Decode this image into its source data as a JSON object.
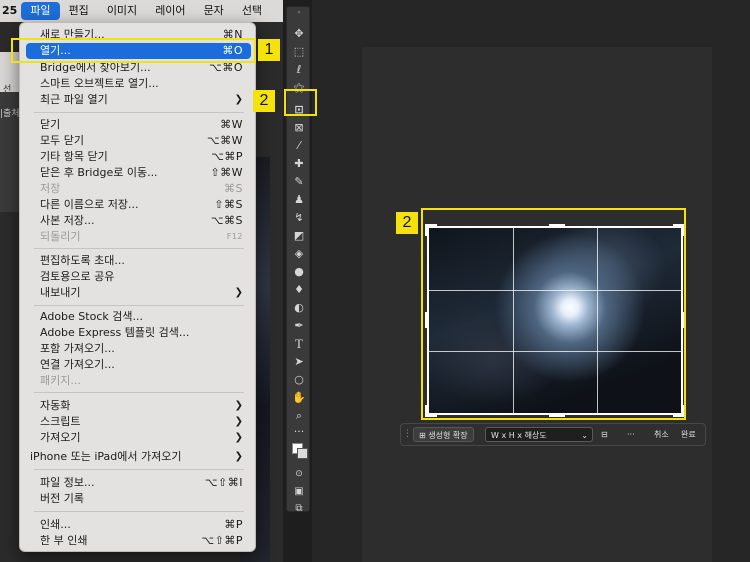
{
  "menubar": {
    "app_fragment": "25",
    "items": [
      "파일",
      "편집",
      "이미지",
      "레이어",
      "문자",
      "선택"
    ],
    "active_index": 0
  },
  "left_panel": {
    "partial_text_1": "선",
    "partial_text_2": "|출처"
  },
  "file_menu": {
    "items": [
      {
        "label": "새로 만들기...",
        "shortcut": "⌘N"
      },
      {
        "label": "열기...",
        "shortcut": "⌘O",
        "selected": true
      },
      {
        "label": "Bridge에서 찾아보기...",
        "shortcut": "⌥⌘O"
      },
      {
        "label": "스마트 오브젝트로 열기...",
        "shortcut": ""
      },
      {
        "label": "최근 파일 열기",
        "shortcut": "",
        "submenu": true
      },
      {
        "label": "닫기",
        "shortcut": "⌘W"
      },
      {
        "label": "모두 닫기",
        "shortcut": "⌥⌘W"
      },
      {
        "label": "기타 항목 닫기",
        "shortcut": "⌥⌘P"
      },
      {
        "label": "닫은 후 Bridge로 이동...",
        "shortcut": "⇧⌘W"
      },
      {
        "label": "저장",
        "shortcut": "⌘S",
        "disabled": true
      },
      {
        "label": "다른 이름으로 저장...",
        "shortcut": "⇧⌘S"
      },
      {
        "label": "사본 저장...",
        "shortcut": "⌥⌘S"
      },
      {
        "label": "되돌리기",
        "shortcut": "F12",
        "disabled": true
      },
      {
        "label": "편집하도록 초대...",
        "shortcut": ""
      },
      {
        "label": "검토용으로 공유",
        "shortcut": ""
      },
      {
        "label": "내보내기",
        "shortcut": "",
        "submenu": true
      },
      {
        "label": "Adobe Stock 검색...",
        "shortcut": ""
      },
      {
        "label": "Adobe Express 템플릿 검색...",
        "shortcut": ""
      },
      {
        "label": "포함 가져오기...",
        "shortcut": ""
      },
      {
        "label": "연결 가져오기...",
        "shortcut": ""
      },
      {
        "label": "패키지...",
        "shortcut": "",
        "disabled": true
      },
      {
        "label": "자동화",
        "shortcut": "",
        "submenu": true
      },
      {
        "label": "스크립트",
        "shortcut": "",
        "submenu": true
      },
      {
        "label": "가져오기",
        "shortcut": "",
        "submenu": true
      },
      {
        "label": "iPhone 또는 iPad에서 가져오기",
        "shortcut": "",
        "submenu": true
      },
      {
        "label": "파일 정보...",
        "shortcut": "⌥⇧⌘I"
      },
      {
        "label": "버전 기록",
        "shortcut": ""
      },
      {
        "label": "인쇄...",
        "shortcut": "⌘P"
      },
      {
        "label": "한 부 인쇄",
        "shortcut": "⌥⇧⌘P"
      }
    ]
  },
  "annotations": {
    "badge_1": "1",
    "badge_2": "2",
    "badge_3": "2"
  },
  "taskbar": {
    "generative_expand": "생성형 확장",
    "ratio_select": "W x H x 해상도",
    "more": "···",
    "cancel": "취소",
    "done": "완료"
  },
  "colors": {
    "highlight": "#f4e20c",
    "menu_selection": "#1b6ddc"
  }
}
